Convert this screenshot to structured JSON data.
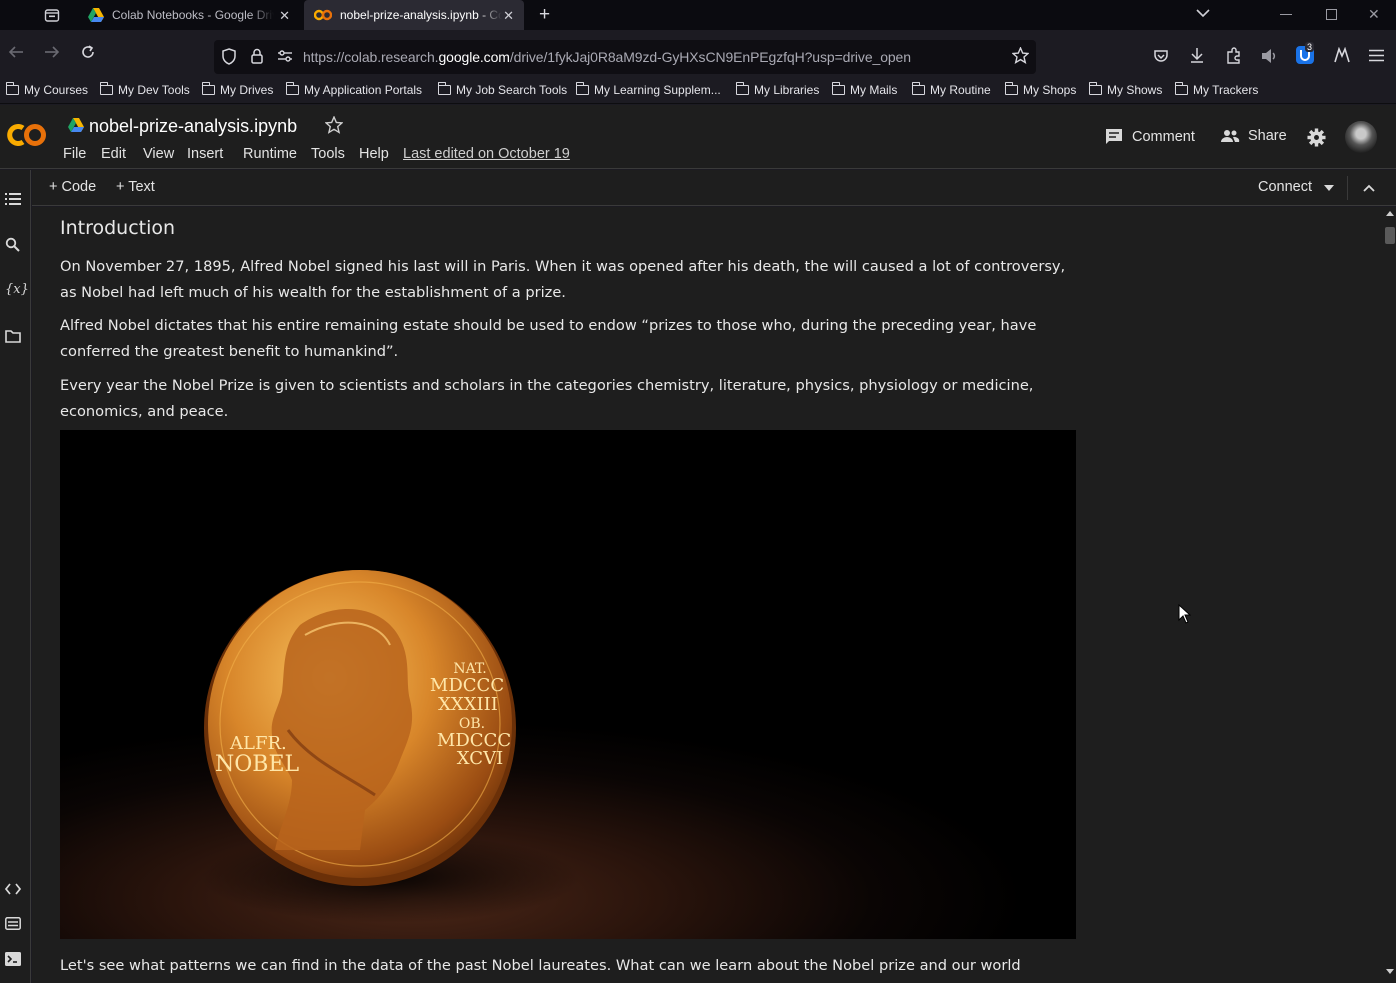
{
  "browser": {
    "tabs": [
      {
        "title": "Colab Notebooks - Google Drive",
        "active": false
      },
      {
        "title": "nobel-prize-analysis.ipynb - Colab",
        "active": true
      }
    ],
    "new_tab": "+",
    "url_prefix": "https://colab.research.",
    "url_domain": "google.com",
    "url_path": "/drive/1fykJaj0R8aM9zd-GyHXsCN9EnPEgzfqH?usp=drive_open",
    "extension_badge": "3",
    "bookmarks": [
      "My Courses",
      "My Dev Tools",
      "My Drives",
      "My Application Portals",
      "My Job Search Tools",
      "My Learning Supplem...",
      "My Libraries",
      "My Mails",
      "My Routine",
      "My Shops",
      "My Shows",
      "My Trackers"
    ]
  },
  "colab": {
    "logo": "CO",
    "notebook_title": "nobel-prize-analysis.ipynb",
    "menu": [
      "File",
      "Edit",
      "View",
      "Insert",
      "Runtime",
      "Tools",
      "Help"
    ],
    "last_edited": "Last edited on October 19",
    "comment_label": "Comment",
    "share_label": "Share",
    "toolbar": {
      "code_label": "+ Code",
      "text_label": "+ Text",
      "connect_label": "Connect"
    }
  },
  "notebook": {
    "heading": "Introduction",
    "paragraphs": [
      "On November 27, 1895, Alfred Nobel signed his last will in Paris. When it was opened after his death, the will caused a lot of controversy, as Nobel had left much of his wealth for the establishment of a prize.",
      "Alfred Nobel dictates that his entire remaining estate should be used to endow “prizes to those who, during the preceding year, have conferred the greatest benefit to humankind”.",
      "Every year the Nobel Prize is given to scientists and scholars in the categories chemistry, literature, physics, physiology or medicine, economics, and peace."
    ],
    "medal_left_text": [
      "ALFR.",
      "NOBEL"
    ],
    "medal_right_text": [
      "NAT.",
      "MDCCC",
      "XXXIII",
      "OB.",
      "MDCCC",
      "XCVI"
    ],
    "bottom_paragraph": "Let's see what patterns we can find in the data of the past Nobel laureates. What can we learn about the Nobel prize and our world"
  }
}
